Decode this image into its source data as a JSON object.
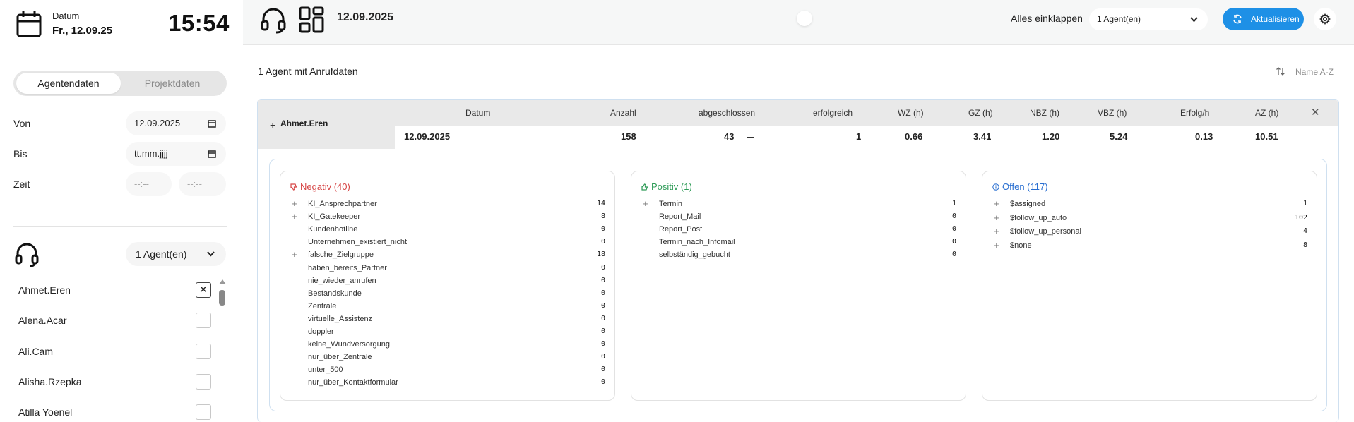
{
  "header": {
    "date_label": "Datum",
    "date_value": "Fr., 12.09.25",
    "clock": "15:54"
  },
  "sidebar": {
    "tabs": [
      {
        "label": "Agentendaten",
        "active": true
      },
      {
        "label": "Projektdaten",
        "active": false
      }
    ],
    "from_label": "Von",
    "from_value": "12.09.2025",
    "to_label": "Bis",
    "to_placeholder": "tt.mm.jjjj",
    "time_label": "Zeit",
    "time_from_placeholder": "--:--",
    "time_to_placeholder": "--:--",
    "agent_select": "1 Agent(en)",
    "agents": [
      {
        "name": "Ahmet.Eren",
        "checked": true
      },
      {
        "name": "Alena.Acar",
        "checked": false
      },
      {
        "name": "Ali.Cam",
        "checked": false
      },
      {
        "name": "Alisha.Rzepka",
        "checked": false
      },
      {
        "name": "Atilla Yoenel",
        "checked": false
      }
    ]
  },
  "topbar": {
    "date": "12.09.2025",
    "collapse_label": "Alles einklappen",
    "agent_select": "1 Agent(en)",
    "refresh_label": "Aktualisieren",
    "accent_color": "#1e90e6"
  },
  "main": {
    "count_label": "1 Agent mit Anrufdaten",
    "sort_label": "Name A-Z",
    "agent": "Ahmet.Eren",
    "columns": [
      "Datum",
      "Anzahl",
      "abgeschlossen",
      "erfolgreich",
      "WZ (h)",
      "GZ (h)",
      "NBZ (h)",
      "VBZ (h)",
      "Erfolg/h",
      "AZ (h)"
    ],
    "row": [
      "12.09.2025",
      "158",
      "43",
      "1",
      "0.66",
      "3.41",
      "1.20",
      "5.24",
      "0.13",
      "10.51"
    ]
  },
  "categories": {
    "negative": {
      "title": "Negativ (40)",
      "color": "#d64545",
      "items": [
        {
          "label": "KI_Ansprechpartner",
          "value": "14",
          "expandable": true
        },
        {
          "label": "KI_Gatekeeper",
          "value": "8",
          "expandable": true
        },
        {
          "label": "Kundenhotline",
          "value": "0",
          "expandable": false
        },
        {
          "label": "Unternehmen_existiert_nicht",
          "value": "0",
          "expandable": false
        },
        {
          "label": "falsche_Zielgruppe",
          "value": "18",
          "expandable": true
        },
        {
          "label": "haben_bereits_Partner",
          "value": "0",
          "expandable": false
        },
        {
          "label": "nie_wieder_anrufen",
          "value": "0",
          "expandable": false
        },
        {
          "label": "Bestandskunde",
          "value": "0",
          "expandable": false
        },
        {
          "label": "Zentrale",
          "value": "0",
          "expandable": false
        },
        {
          "label": "virtuelle_Assistenz",
          "value": "0",
          "expandable": false
        },
        {
          "label": "doppler",
          "value": "0",
          "expandable": false
        },
        {
          "label": "keine_Wundversorgung",
          "value": "0",
          "expandable": false
        },
        {
          "label": "nur_über_Zentrale",
          "value": "0",
          "expandable": false
        },
        {
          "label": "unter_500",
          "value": "0",
          "expandable": false
        },
        {
          "label": "nur_über_Kontaktformular",
          "value": "0",
          "expandable": false
        }
      ]
    },
    "positive": {
      "title": "Positiv (1)",
      "color": "#2e9b57",
      "items": [
        {
          "label": "Termin",
          "value": "1",
          "expandable": true
        },
        {
          "label": "Report_Mail",
          "value": "0",
          "expandable": false
        },
        {
          "label": "Report_Post",
          "value": "0",
          "expandable": false
        },
        {
          "label": "Termin_nach_Infomail",
          "value": "0",
          "expandable": false
        },
        {
          "label": "selbständig_gebucht",
          "value": "0",
          "expandable": false
        }
      ]
    },
    "open": {
      "title": "Offen (117)",
      "color": "#2a6fd1",
      "items": [
        {
          "label": "$assigned",
          "value": "1",
          "expandable": true
        },
        {
          "label": "$follow_up_auto",
          "value": "102",
          "expandable": true
        },
        {
          "label": "$follow_up_personal",
          "value": "4",
          "expandable": true
        },
        {
          "label": "$none",
          "value": "8",
          "expandable": true
        }
      ]
    }
  }
}
